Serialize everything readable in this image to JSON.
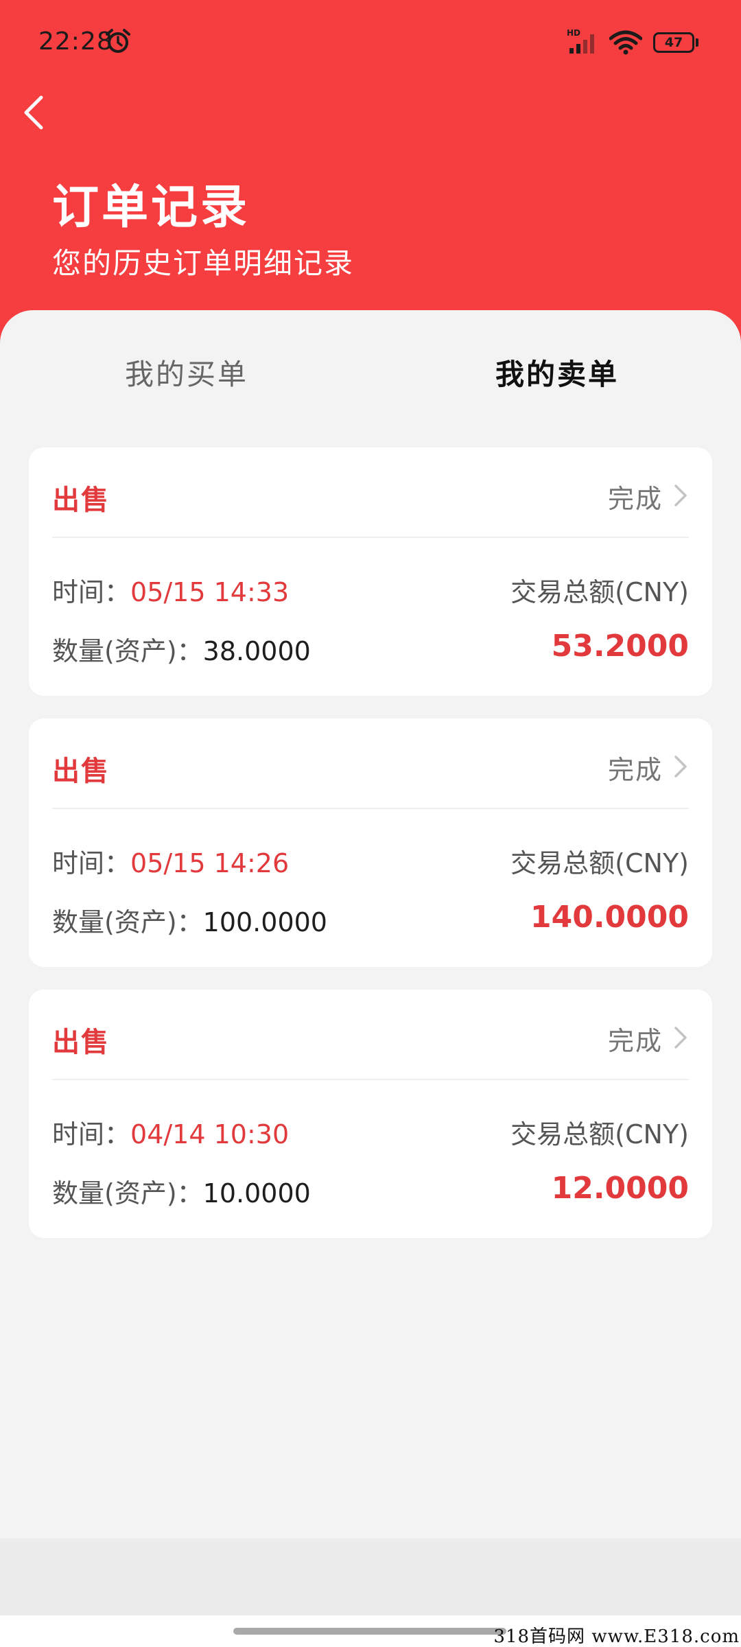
{
  "status_bar": {
    "time": "22:28",
    "battery": "47"
  },
  "header": {
    "title": "订单记录",
    "subtitle": "您的历史订单明细记录"
  },
  "tabs": [
    {
      "label": "我的买单",
      "active": false
    },
    {
      "label": "我的卖单",
      "active": true
    }
  ],
  "labels": {
    "time": "时间：",
    "quantity": "数量(资产)：",
    "amount": "交易总额(CNY)"
  },
  "orders": [
    {
      "type": "出售",
      "status": "完成",
      "time": "05/15 14:33",
      "quantity": "38.0000",
      "amount": "53.2000"
    },
    {
      "type": "出售",
      "status": "完成",
      "time": "05/15 14:26",
      "quantity": "100.0000",
      "amount": "140.0000"
    },
    {
      "type": "出售",
      "status": "完成",
      "time": "04/14 10:30",
      "quantity": "10.0000",
      "amount": "12.0000"
    }
  ],
  "watermark": "318首码网 www.E318.com",
  "colors": {
    "brand_red": "#f63d3f",
    "accent_red": "#e23a3c",
    "background": "#f3f3f3"
  }
}
